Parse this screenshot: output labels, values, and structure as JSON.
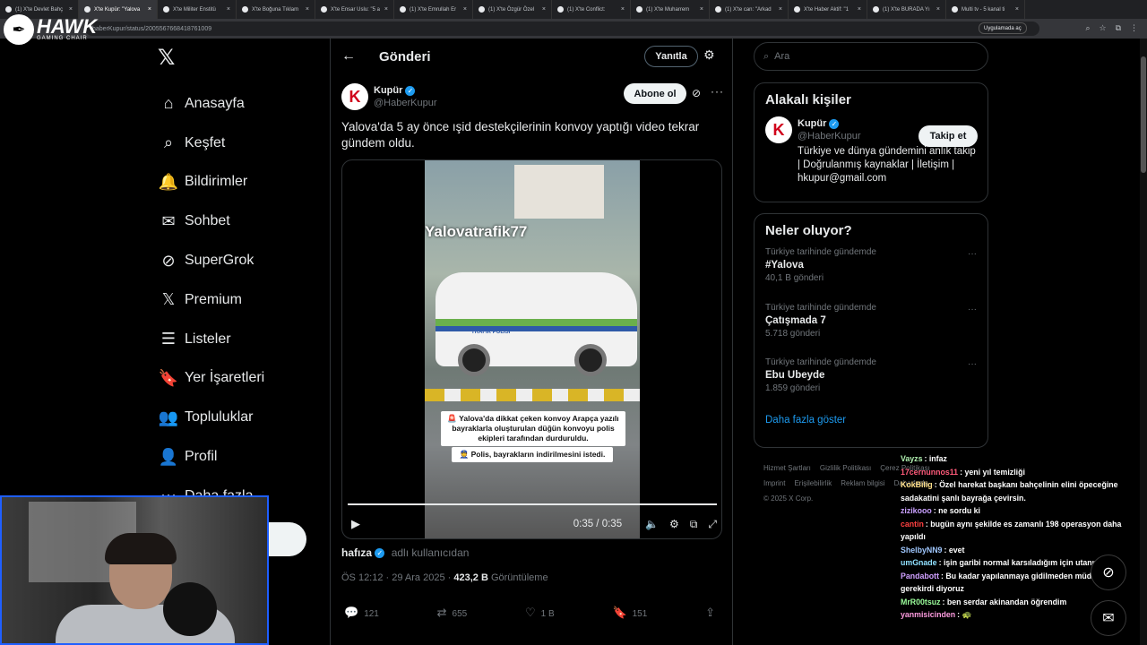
{
  "browser": {
    "tabs": [
      {
        "label": "(1) X'te Devlet Bahç"
      },
      {
        "label": "X'te Kupür: \"Yalova"
      },
      {
        "label": "X'te Militer Enstitü"
      },
      {
        "label": "X'te Boğuna Tıklam"
      },
      {
        "label": "X'te Ensar Uslu: \"5 a"
      },
      {
        "label": "(1) X'te Emrullah Er"
      },
      {
        "label": "(1) X'te Özgür Özel"
      },
      {
        "label": "(1) X'te Conflict:"
      },
      {
        "label": "(1) X'te Muharrem"
      },
      {
        "label": "(1) X'te can: \"Arkad"
      },
      {
        "label": "X'te Haber Aktif: \"1"
      },
      {
        "label": "(1) X'te BURADA Yı"
      },
      {
        "label": "Multi tv - 5 kanal ti"
      }
    ],
    "url": "haberKupur/status/2005567668418761009",
    "open_in_app": "Uygulamada aç"
  },
  "overlay_logo": {
    "brand": "HAWK",
    "tagline": "GAMING CHAIR"
  },
  "nav": {
    "items": [
      {
        "label": "Anasayfa",
        "icon": "home-icon"
      },
      {
        "label": "Keşfet",
        "icon": "search-icon"
      },
      {
        "label": "Bildirimler",
        "icon": "bell-icon"
      },
      {
        "label": "Sohbet",
        "icon": "mail-icon"
      },
      {
        "label": "SuperGrok",
        "icon": "grok-icon"
      },
      {
        "label": "Premium",
        "icon": "x-icon"
      },
      {
        "label": "Listeler",
        "icon": "list-icon"
      },
      {
        "label": "Yer İşaretleri",
        "icon": "bookmark-icon"
      },
      {
        "label": "Topluluklar",
        "icon": "people-icon"
      },
      {
        "label": "Profil",
        "icon": "user-icon"
      },
      {
        "label": "Daha fazla",
        "icon": "more-circle-icon"
      }
    ],
    "post_button": "a"
  },
  "post": {
    "header_title": "Gönderi",
    "reply_button": "Yanıtla",
    "author_name": "Kupür",
    "author_handle": "@HaberKupur",
    "avatar_letter": "K",
    "follow_button": "Abone ol",
    "text": "Yalova'da 5 ay önce ışid destekçilerinin konvoy yaptığı video tekrar gündem oldu.",
    "video": {
      "watermark": "Yalovatrafik77",
      "car_label": "TRAFİK POLİSİ",
      "caption_1": "🚨 Yalova'da dikkat çeken konvoy Arapça yazılı bayraklarla oluşturulan düğün konvoyu polis ekipleri tarafından durduruldu.",
      "caption_2": "👮 Polis, bayrakların indirilmesini istedi.",
      "time": "0:35 / 0:35"
    },
    "from_user": "hafıza",
    "from_suffix": "adlı kullanıcıdan",
    "timestamp": "ÖS 12:12 · 29 Ara 2025 ·",
    "views": "423,2 B",
    "views_label": "Görüntüleme",
    "actions": {
      "replies": "121",
      "reposts": "655",
      "likes": "1 B",
      "bookmarks": "151"
    }
  },
  "right": {
    "search_placeholder": "Ara",
    "related_title": "Alakalı kişiler",
    "related": {
      "name": "Kupür",
      "handle": "@HaberKupur",
      "follow": "Takip et",
      "bio": "Türkiye ve dünya gündemini anlık takip | Doğrulanmış kaynaklar | İletişim | hkupur@gmail.com"
    },
    "trends_title": "Neler oluyor?",
    "trends": [
      {
        "context": "Türkiye tarihinde gündemde",
        "name": "#Yalova",
        "count": "40,1 B gönderi"
      },
      {
        "context": "Türkiye tarihinde gündemde",
        "name": "Çatışmada 7",
        "count": "5.718 gönderi"
      },
      {
        "context": "Türkiye tarihinde gündemde",
        "name": "Ebu Ubeyde",
        "count": "1.859 gönderi"
      }
    ],
    "show_more": "Daha fazla göster",
    "footer": [
      "Hizmet Şartları",
      "Gizlilik Politikası",
      "Çerez Politikası",
      "Imprint",
      "Erişilebilirlik",
      "Reklam bilgisi",
      "Daha fazla ...",
      "© 2025 X Corp."
    ]
  },
  "chat": [
    {
      "user": "Vayzs",
      "msg": "infaz",
      "color": "#b0f0b0"
    },
    {
      "user": "17cernunnos11",
      "msg": "yeni yıl temizliği",
      "color": "#ff5a7a"
    },
    {
      "user": "KokBilig",
      "msg": "Özel harekat başkanı bahçelinin elini öpeceğine sadakatini şanlı bayrağa çevirsin.",
      "color": "#ffe08a"
    },
    {
      "user": "zizikooo",
      "msg": "ne sordu ki",
      "color": "#c9a0ff"
    },
    {
      "user": "cantin",
      "msg": "bugün aynı şekilde es zamanlı 198 operasyon daha yapıldı",
      "color": "#ff4040"
    },
    {
      "user": "ShelbyNN9",
      "msg": "evet",
      "color": "#a0c8ff"
    },
    {
      "user": "umGnade",
      "msg": "işin garibi normal karsıladığım için utanıyorum",
      "color": "#90e0ff"
    },
    {
      "user": "Pandabott",
      "msg": "Bu kadar yapılanmaya gidilmeden müdahale gerekirdi diyoruz",
      "color": "#d0a0ff"
    },
    {
      "user": "MrR00tsuz",
      "msg": "ben serdar akinandan öğrendim",
      "color": "#9cff9c"
    },
    {
      "user": "yanmisicinden",
      "msg": "🐢",
      "color": "#ff9ce0"
    }
  ]
}
